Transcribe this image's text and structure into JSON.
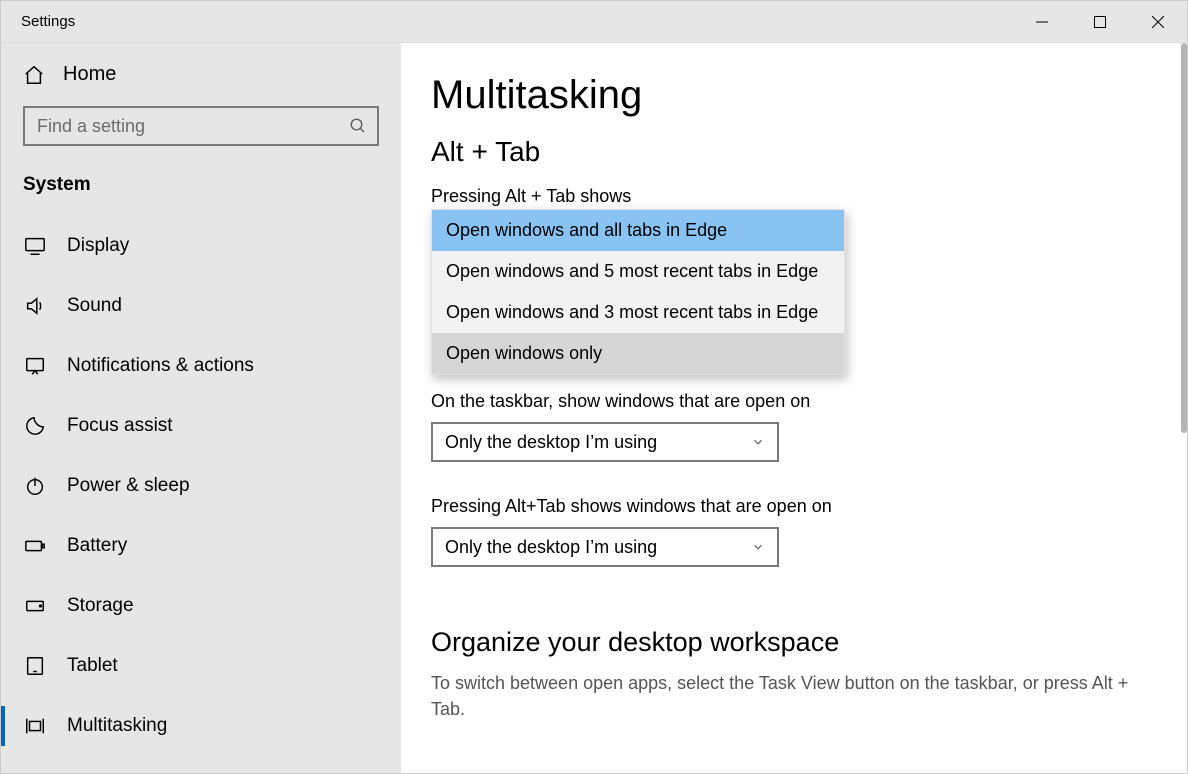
{
  "window": {
    "title": "Settings"
  },
  "sidebar": {
    "home_label": "Home",
    "search_placeholder": "Find a setting",
    "section_label": "System",
    "items": [
      {
        "label": "Display",
        "icon": "display"
      },
      {
        "label": "Sound",
        "icon": "sound"
      },
      {
        "label": "Notifications & actions",
        "icon": "notifications"
      },
      {
        "label": "Focus assist",
        "icon": "focus"
      },
      {
        "label": "Power & sleep",
        "icon": "power"
      },
      {
        "label": "Battery",
        "icon": "battery"
      },
      {
        "label": "Storage",
        "icon": "storage"
      },
      {
        "label": "Tablet",
        "icon": "tablet"
      },
      {
        "label": "Multitasking",
        "icon": "multitasking"
      }
    ],
    "selected_index": 8
  },
  "main": {
    "page_title": "Multitasking",
    "section_alt_tab": "Alt + Tab",
    "alt_tab_label": "Pressing Alt + Tab shows",
    "alt_tab_options": [
      "Open windows and all tabs in Edge",
      "Open windows and 5 most recent tabs in Edge",
      "Open windows and 3 most recent tabs in Edge",
      "Open windows only"
    ],
    "alt_tab_highlighted_index": 0,
    "alt_tab_selected_index": 3,
    "taskbar_label": "On the taskbar, show windows that are open on",
    "taskbar_value": "Only the desktop I’m using",
    "alttab_windows_label": "Pressing Alt+Tab shows windows that are open on",
    "alttab_windows_value": "Only the desktop I’m using",
    "organize_heading": "Organize your desktop workspace",
    "organize_body": "To switch between open apps, select the Task View button on the taskbar, or press Alt + Tab."
  }
}
